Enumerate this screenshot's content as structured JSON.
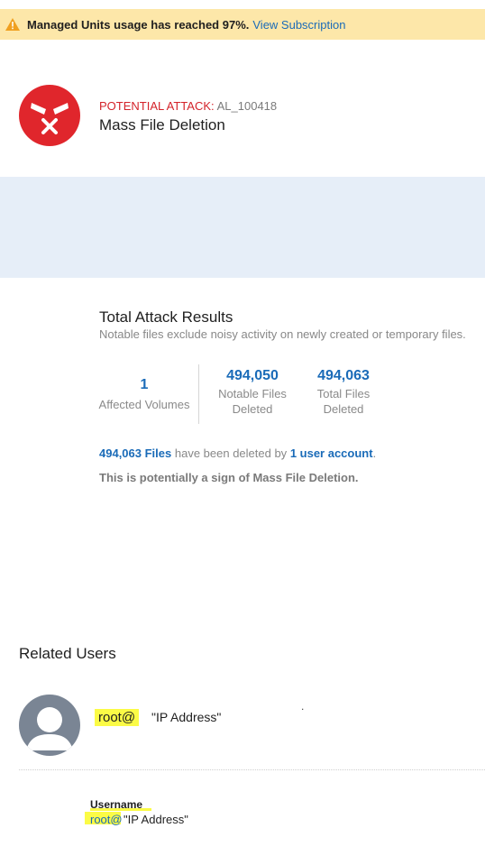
{
  "banner": {
    "message": "Managed Units usage has reached 97%.",
    "link_label": "View Subscription",
    "icon": "warning-icon",
    "color": "#fde7a9"
  },
  "alert": {
    "type_label": "POTENTIAL ATTACK:",
    "id": "AL_100418",
    "title": "Mass File Deletion",
    "icon": "attack-face-icon",
    "color": "#e0262c"
  },
  "results": {
    "title": "Total Attack Results",
    "subtitle": "Notable files exclude noisy activity on newly created or temporary files.",
    "stats": [
      {
        "value": "1",
        "label": "Affected Volumes"
      },
      {
        "value": "494,050",
        "label": "Notable Files Deleted"
      },
      {
        "value": "494,063",
        "label": "Total Files Deleted"
      }
    ],
    "deleted_files": "494,063 Files",
    "deleted_mid": "have been deleted by",
    "deleted_account": "1 user account",
    "deleted_end": ".",
    "sign_text": "This is potentially a sign of Mass File Deletion."
  },
  "related": {
    "title": "Related Users",
    "user": {
      "name": "root@",
      "ip": "\"IP Address\"",
      "dot": "."
    },
    "details": {
      "label": "Username",
      "value": "root@",
      "ip": "\"IP Address\""
    }
  }
}
